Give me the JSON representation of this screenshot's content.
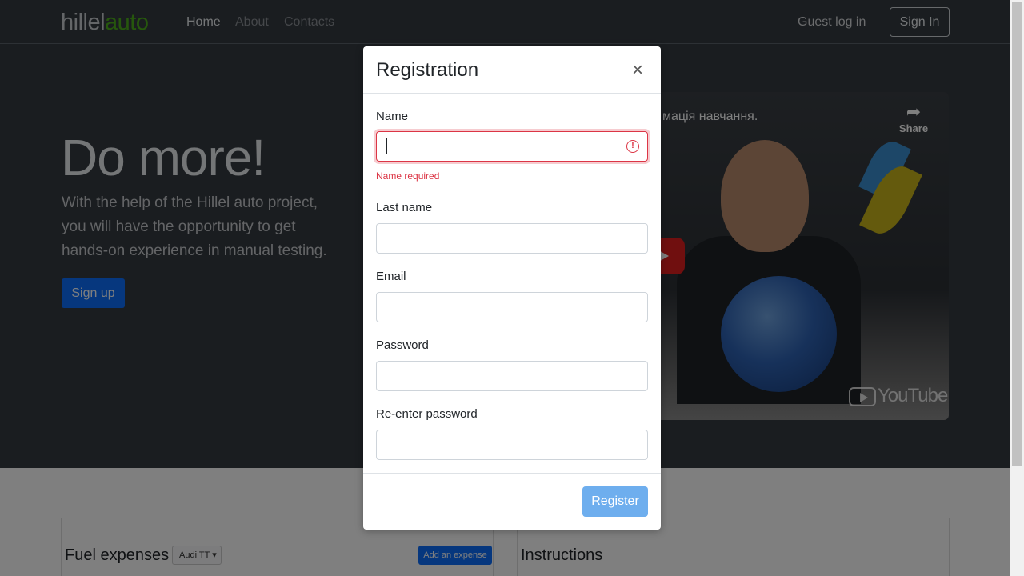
{
  "navbar": {
    "logo_part1": "hillel",
    "logo_part2": "auto",
    "links": [
      "Home",
      "About",
      "Contacts"
    ],
    "guest_login": "Guest log in",
    "sign_in": "Sign In"
  },
  "hero": {
    "title": "Do more!",
    "text": "With the help of the Hillel auto project, you will have the opportunity to get hands-on experience in manual testing.",
    "signup": "Sign up"
  },
  "video": {
    "caption": "мація навчання.",
    "share": "Share",
    "share_icon": "share-arrow-icon",
    "brand": "YouTube"
  },
  "lower": {
    "fuel_title": "Fuel expenses",
    "car_select": "Audi TT",
    "add_expense": "Add an expense",
    "instructions_title": "Instructions"
  },
  "modal": {
    "title": "Registration",
    "close": "×",
    "fields": {
      "name": {
        "label": "Name",
        "value": "",
        "error": "Name required"
      },
      "last_name": {
        "label": "Last name",
        "value": ""
      },
      "email": {
        "label": "Email",
        "value": ""
      },
      "password": {
        "label": "Password",
        "value": ""
      },
      "repassword": {
        "label": "Re-enter password",
        "value": ""
      }
    },
    "register": "Register"
  },
  "colors": {
    "brand_green": "#4caf1a",
    "primary": "#0d6efd",
    "danger": "#dc3545",
    "navbar_bg": "#343a40"
  }
}
